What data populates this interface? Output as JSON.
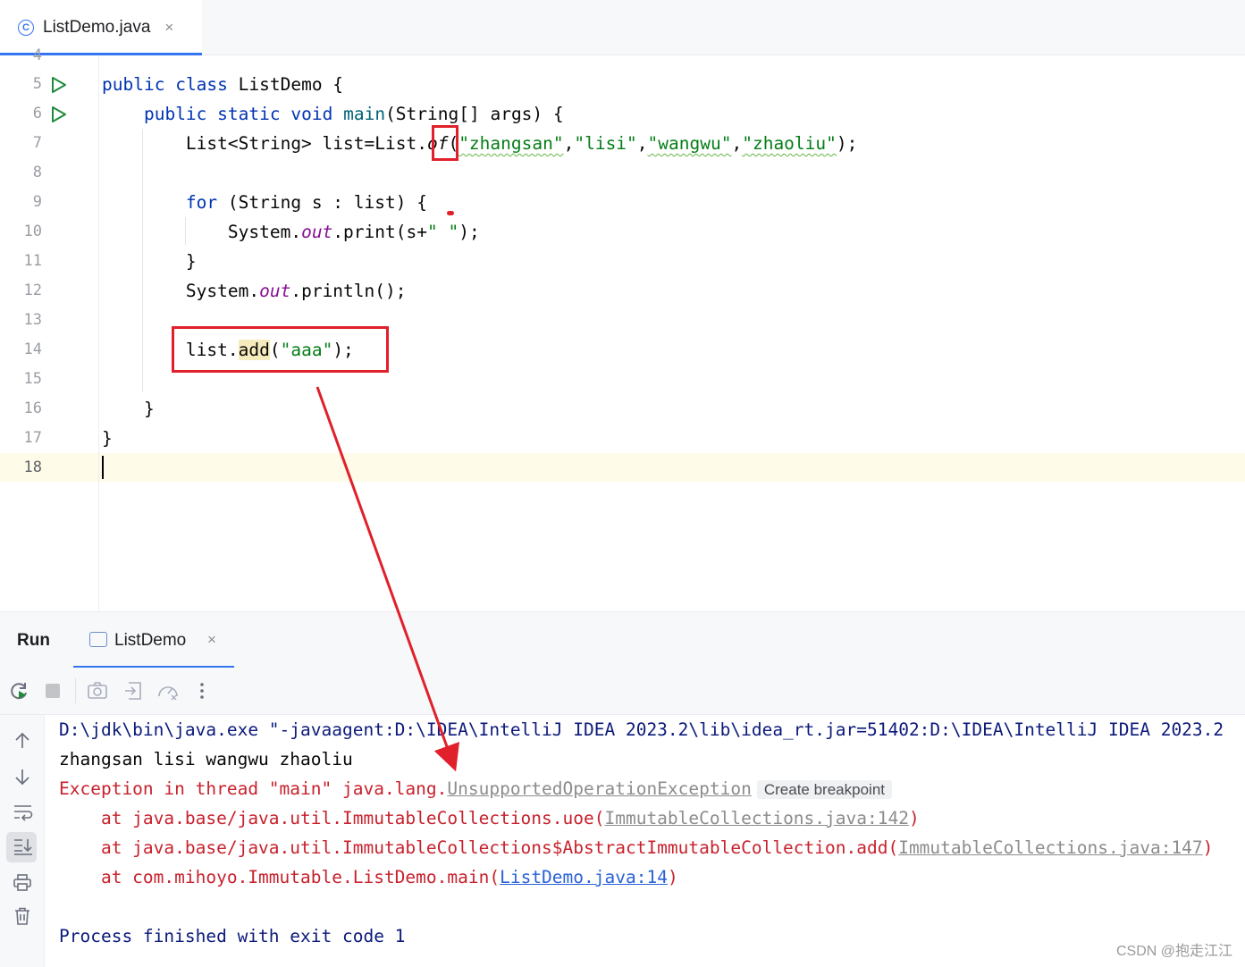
{
  "editor_tab": {
    "filename": "ListDemo.java",
    "close": "×",
    "icon": "class-icon",
    "icon_glyph": "C"
  },
  "editor": {
    "partial_line_number": "4",
    "line_numbers": [
      "5",
      "6",
      "7",
      "8",
      "9",
      "10",
      "11",
      "12",
      "13",
      "14",
      "15",
      "16",
      "17",
      "18"
    ],
    "code": {
      "l5": {
        "kw1": "public",
        "kw2": "class",
        "rest": " ListDemo {"
      },
      "l6": {
        "kw1": "public",
        "kw2": "static",
        "kw3": "void",
        "method": "main",
        "rest": "(String[] args) {"
      },
      "l7": {
        "pre": "List<String> list=List.",
        "of": "of",
        "open": "(",
        "s1": "\"zhangsan\"",
        "s2": "\"lisi\"",
        "s3": "\"wangwu\"",
        "s4": "\"zhaoliu\"",
        "close": ");",
        "comma": ","
      },
      "l9": {
        "kw": "for",
        "rest": " (String s : list) {"
      },
      "l10": {
        "pre": "System.",
        "field": "out",
        "mid": ".print(s+",
        "str": "\" \"",
        "end": ");"
      },
      "l11": {
        "text": "}"
      },
      "l12": {
        "pre": "System.",
        "field": "out",
        "end": ".println();"
      },
      "l14": {
        "pre": "list.",
        "method": "add",
        "open": "(",
        "str": "\"aaa\"",
        "end": ");"
      },
      "l16": {
        "text": "}"
      },
      "l17": {
        "text": "}"
      }
    }
  },
  "run_panel": {
    "title": "Run",
    "tab_label": "ListDemo",
    "tab_close": "×",
    "toolbar_icons": [
      "rerun-icon",
      "stop-icon",
      "screenshot-icon",
      "restore-layout-icon",
      "profiler-icon",
      "more-options-icon"
    ],
    "side_icons": [
      "scroll-up-icon",
      "scroll-down-icon",
      "soft-wrap-icon",
      "scroll-to-end-icon",
      "print-icon",
      "clear-icon"
    ]
  },
  "console": {
    "cmd": "D:\\jdk\\bin\\java.exe \"-javaagent:D:\\IDEA\\IntelliJ IDEA 2023.2\\lib\\idea_rt.jar=51402:D:\\IDEA\\IntelliJ IDEA 2023.2",
    "output": "zhangsan lisi wangwu zhaoliu",
    "exception_prefix": "Exception in thread \"main\" java.lang.",
    "exception_name": "UnsupportedOperationException",
    "create_breakpoint": "Create breakpoint",
    "trace1_pre": "    at java.base/java.util.ImmutableCollections.uoe(",
    "trace1_link": "ImmutableCollections.java:142",
    "trace2_pre": "    at java.base/java.util.ImmutableCollections$AbstractImmutableCollection.add(",
    "trace2_link": "ImmutableCollections.java:147",
    "trace3_pre": "    at com.mihoyo.Immutable.ListDemo.main(",
    "trace3_link": "ListDemo.java:14",
    "paren_close": ")",
    "exit_message": "Process finished with exit code 1"
  },
  "watermark": "CSDN @抱走江江",
  "colors": {
    "accent": "#3574f0",
    "annotation_red": "#e0202a",
    "keyword": "#0033b3",
    "string": "#067d17",
    "error": "#c7222d"
  }
}
